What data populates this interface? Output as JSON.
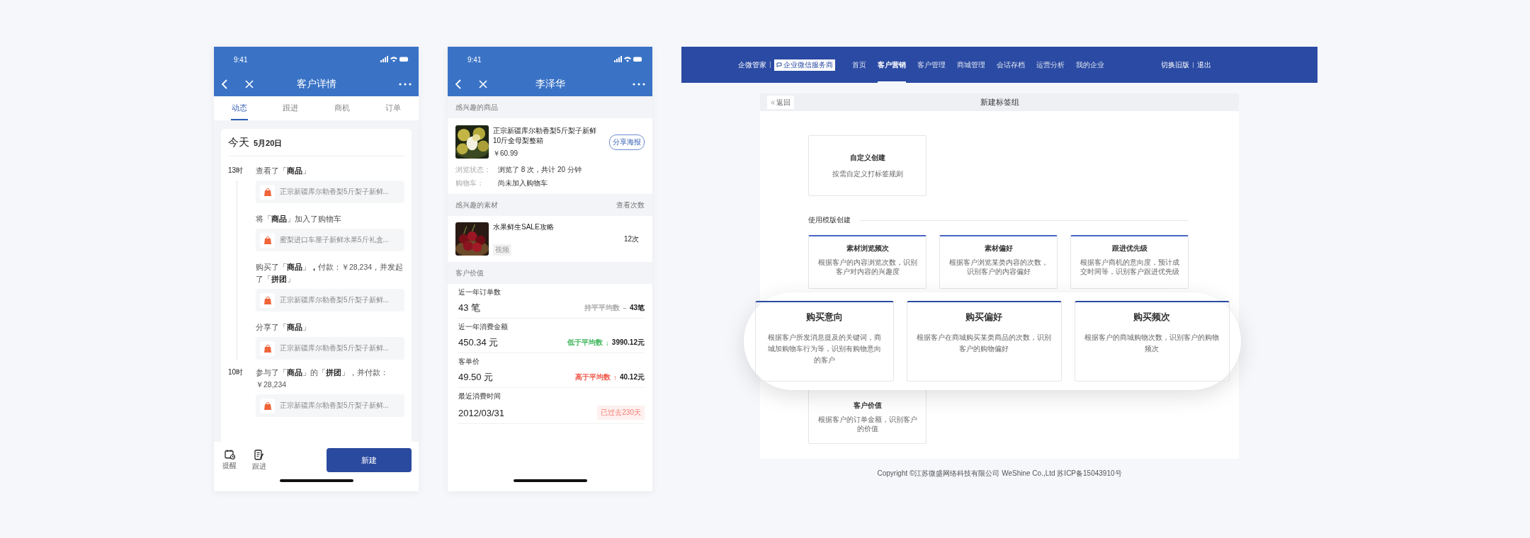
{
  "phone_detail": {
    "status_time": "9:41",
    "title": "客户详情",
    "tabs": [
      {
        "label": "动态",
        "selected": true
      },
      {
        "label": "跟进",
        "selected": false
      },
      {
        "label": "商机",
        "selected": false
      },
      {
        "label": "订单",
        "selected": false
      }
    ],
    "day": {
      "label": "今天",
      "date": "5月20日"
    },
    "groups": [
      {
        "hour": "13时",
        "events": [
          {
            "text": "查看了「**商品**」",
            "product": "正宗新疆库尔勒香梨5斤梨子新鲜..."
          },
          {
            "text": "将「**商品**」加入了购物车",
            "product": "蜜梨进口车厘子新鲜水果5斤礼盒..."
          },
          {
            "text": "购买了「**商品**」**，**付款：￥28,234，并发起了「**拼团**」",
            "product": "正宗新疆库尔勒香梨5斤梨子新鲜..."
          },
          {
            "text": "分享了「**商品**」",
            "product": "正宗新疆库尔勒香梨5斤梨子新鲜..."
          }
        ]
      },
      {
        "hour": "10时",
        "events": [
          {
            "text": "参与了「**商品**」的「**拼团**」，并付款：￥28,234",
            "product": "正宗新疆库尔勒香梨5斤梨子新鲜..."
          }
        ]
      }
    ],
    "bottom_actions": [
      {
        "label": "提醒",
        "kind": "reminder"
      },
      {
        "label": "跟进",
        "kind": "note"
      }
    ],
    "primary_button": "新建"
  },
  "phone_customer": {
    "status_time": "9:41",
    "title": "李泽华",
    "product_section": {
      "title": "感兴趣的商品",
      "name": "正宗新疆库尔勒香梨5斤梨子新鲜10斤全母梨整箱",
      "price": "￥60.99",
      "share_button": "分享海报",
      "details": [
        {
          "label": "浏览状态：",
          "value": "浏览了 8 次，共计 20 分钟"
        },
        {
          "label": "购物车：",
          "value": "尚未加入购物车"
        }
      ]
    },
    "material_section": {
      "title": "感兴趣的素材",
      "count_header": "查看次数",
      "items": [
        {
          "title": "水果鲜生SALE攻略",
          "tag": "视频",
          "count": "12次"
        }
      ]
    },
    "value_section": {
      "title": "客户价值",
      "metrics": [
        {
          "label": "近一年订单数",
          "value": "43 笔",
          "kind": "compare",
          "color": "#aaaaaa",
          "comparison": "持平平均数",
          "arrow": "–",
          "reference": "43笔"
        },
        {
          "label": "近一年消费金额",
          "value": "450.34 元",
          "kind": "compare",
          "color": "#3cb55a",
          "comparison": "低于平均数",
          "arrow": "↓",
          "reference": "3990.12元"
        },
        {
          "label": "客单价",
          "value": "49.50 元",
          "kind": "compare",
          "color": "#f0584a",
          "comparison": "高于平均数",
          "arrow": "↑",
          "reference": "40.12元"
        },
        {
          "label": "最近消费时间",
          "value": "2012/03/31",
          "kind": "badge",
          "badge": "已过去230天"
        }
      ]
    }
  },
  "web": {
    "brand": "企微管家",
    "partner_badge": "企业微信服务商",
    "nav": [
      {
        "label": "首页",
        "selected": false
      },
      {
        "label": "客户营销",
        "selected": true
      },
      {
        "label": "客户管理",
        "selected": false
      },
      {
        "label": "商城管理",
        "selected": false
      },
      {
        "label": "会话存档",
        "selected": false
      },
      {
        "label": "运营分析",
        "selected": false
      },
      {
        "label": "我的企业",
        "selected": false
      }
    ],
    "header_links": [
      "切换旧版",
      "退出"
    ],
    "panel": {
      "back_button": "返回",
      "title": "新建标签组",
      "custom_card": {
        "title": "自定义创建",
        "desc": "按需自定义打标签规则"
      },
      "template_heading": "使用模版创建",
      "template_cards": [
        {
          "title": "素材浏览频次",
          "desc": "根据客户的内容浏览次数，识别客户对内容的兴趣度"
        },
        {
          "title": "素材偏好",
          "desc": "根据客户浏览某类内容的次数，识别客户的内容偏好"
        },
        {
          "title": "跟进优先级",
          "desc": "根据客户商机的意向度，预计成交时间等，识别客户跟进优先级"
        }
      ],
      "value_card": {
        "title": "客户价值",
        "desc": "根据客户的订单金额，识别客户的价值"
      },
      "magnified_cards": [
        {
          "title": "购买意向",
          "desc": "根据客户所发消息提及的关键词，商城加购物车行为等，识别有购物意向的客户"
        },
        {
          "title": "购买偏好",
          "desc": "根据客户在商城购买某类商品的次数，识别客户的购物偏好"
        },
        {
          "title": "购买频次",
          "desc": "根据客户的商城购物次数，识别客户的购物频次"
        }
      ]
    },
    "footer": "Copyright ©江苏微盛网络科技有限公司 WeShine Co.,Ltd 苏ICP备15043910号"
  }
}
